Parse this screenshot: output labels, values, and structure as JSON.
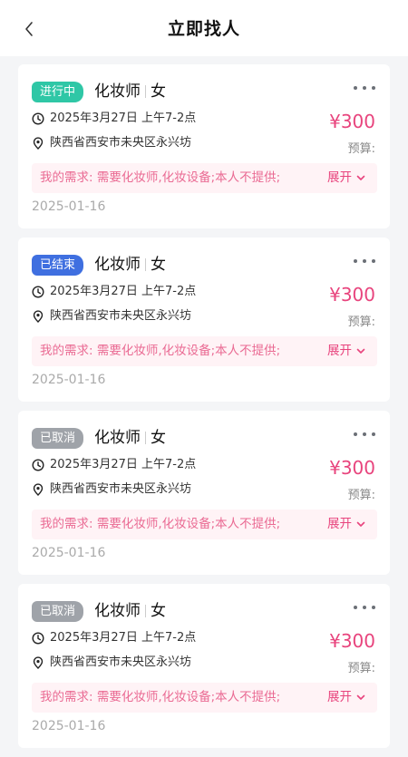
{
  "header": {
    "title": "立即找人"
  },
  "colors": {
    "accent": "#e8447d",
    "in_progress": "#2fc7a6",
    "finished": "#3f6fe0",
    "cancelled": "#9fa3a9"
  },
  "icons": {
    "back": "chevron-left-icon",
    "more": "more-dots-icon",
    "time": "clock-icon",
    "location": "location-pin-icon",
    "expand": "chevron-down-icon"
  },
  "orders": [
    {
      "status": "进行中",
      "role": "化妆师",
      "gender": "女",
      "time": "2025年3月27日 上午7-2点",
      "address": "陕西省西安市未央区永兴坊",
      "price": "¥300",
      "budget_label": "预算:",
      "need": "我的需求: 需要化妆师,化妆设备;本人不提供;",
      "expand_label": "展开",
      "date": "2025-01-16"
    },
    {
      "status": "已结束",
      "role": "化妆师",
      "gender": "女",
      "time": "2025年3月27日 上午7-2点",
      "address": "陕西省西安市未央区永兴坊",
      "price": "¥300",
      "budget_label": "预算:",
      "need": "我的需求: 需要化妆师,化妆设备;本人不提供;",
      "expand_label": "展开",
      "date": "2025-01-16"
    },
    {
      "status": "已取消",
      "role": "化妆师",
      "gender": "女",
      "time": "2025年3月27日 上午7-2点",
      "address": "陕西省西安市未央区永兴坊",
      "price": "¥300",
      "budget_label": "预算:",
      "need": "我的需求: 需要化妆师,化妆设备;本人不提供;",
      "expand_label": "展开",
      "date": "2025-01-16"
    },
    {
      "status": "已取消",
      "role": "化妆师",
      "gender": "女",
      "time": "2025年3月27日 上午7-2点",
      "address": "陕西省西安市未央区永兴坊",
      "price": "¥300",
      "budget_label": "预算:",
      "need": "我的需求: 需要化妆师,化妆设备;本人不提供;",
      "expand_label": "展开",
      "date": "2025-01-16"
    }
  ]
}
